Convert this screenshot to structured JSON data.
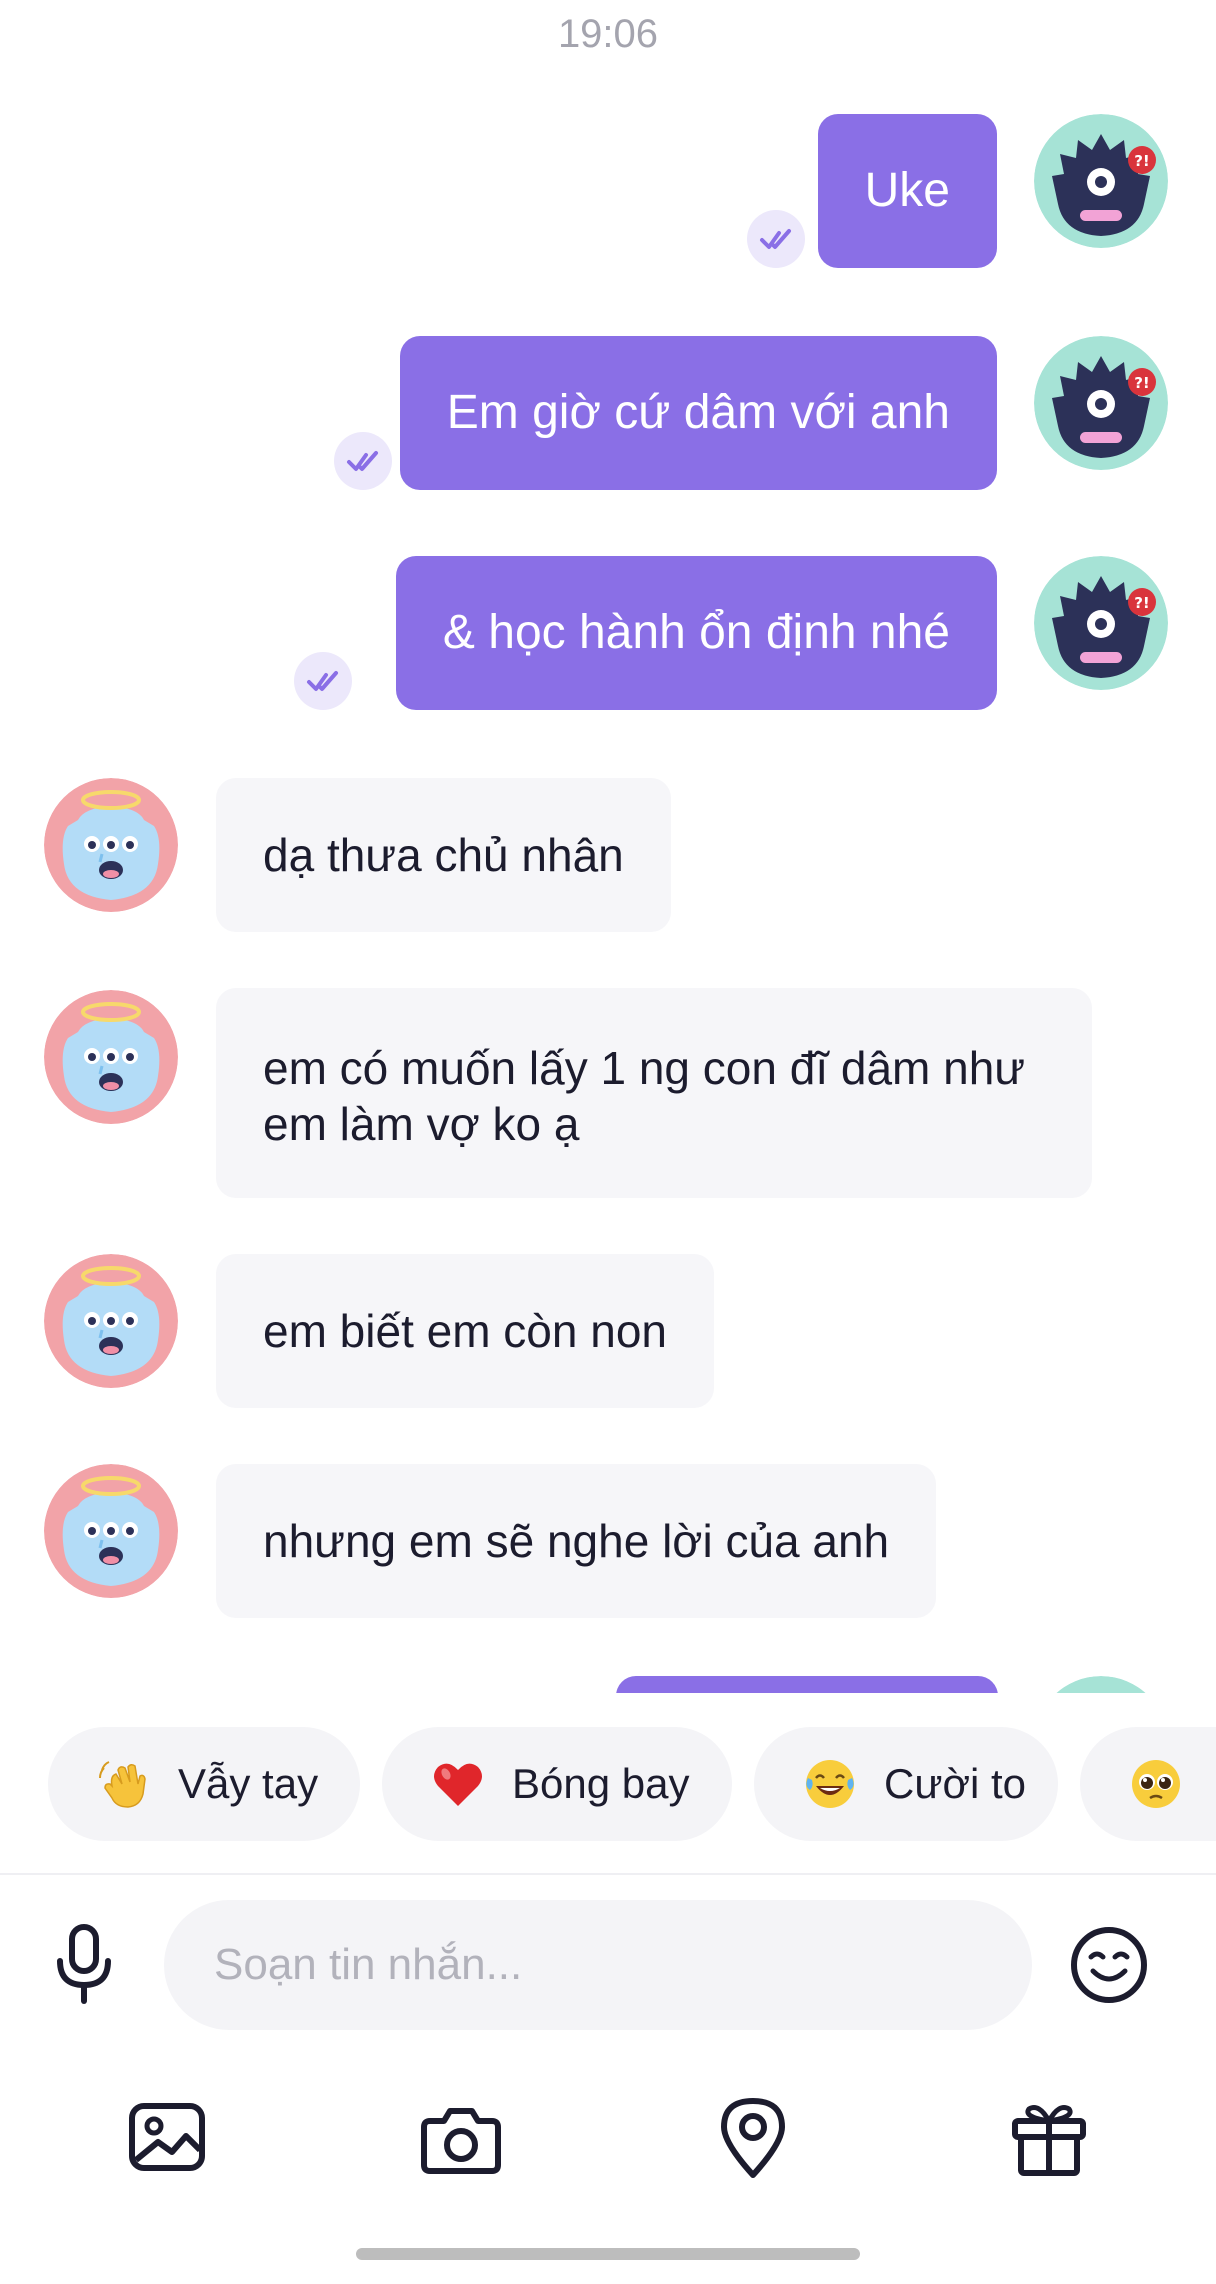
{
  "chat": {
    "timestamp": "19:06",
    "outgoing": [
      {
        "text": "Uke"
      },
      {
        "text": "Em giờ cứ dâm với anh"
      },
      {
        "text": "& học hành ổn định nhé"
      }
    ],
    "incoming": [
      {
        "text": "dạ thưa chủ nhân"
      },
      {
        "text": "em có muốn lấy 1 ng con đĩ dâm như em làm vợ ko ạ"
      },
      {
        "text": "em biết em còn non"
      },
      {
        "text": "nhưng em sẽ nghe lời của anh"
      }
    ]
  },
  "quick_reactions": [
    {
      "label": "Vẫy tay",
      "icon": "waving-hand-icon"
    },
    {
      "label": "Bóng bay",
      "icon": "red-heart-icon"
    },
    {
      "label": "Cười to",
      "icon": "laughing-tears-icon"
    },
    {
      "label": "",
      "icon": "pleading-face-icon"
    }
  ],
  "composer": {
    "placeholder": "Soạn tin nhắn...",
    "mic_icon": "microphone-icon",
    "emoji_icon": "smiley-icon"
  },
  "toolbar": {
    "items": [
      "image-icon",
      "camera-icon",
      "location-pin-icon",
      "gift-icon"
    ]
  },
  "colors": {
    "accent": "#8a6fe6",
    "incoming_bubble": "#f6f6f9",
    "text": "#1c1c2e",
    "muted": "#a4a4ae"
  }
}
